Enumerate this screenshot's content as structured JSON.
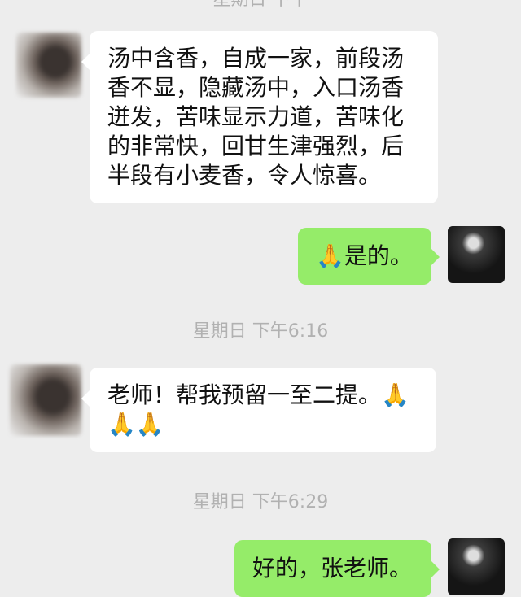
{
  "top_partial_timestamp": "星期日 下午",
  "messages": [
    {
      "side": "in",
      "text": "汤中含香，自成一家，前段汤香不显，隐藏汤中，入口汤香迸发，苦味显示力道，苦味化的非常快，回甘生津强烈，后半段有小麦香，令人惊喜。"
    },
    {
      "side": "out",
      "emoji": "🙏",
      "text": "是的。"
    },
    {
      "timestamp": "星期日 下午6:16"
    },
    {
      "side": "in",
      "text": "老师！帮我预留一至二提。",
      "emojis": "🙏",
      "emoji_line2": "🙏🙏"
    },
    {
      "timestamp": "星期日 下午6:29"
    },
    {
      "side": "out",
      "text": "好的，张老师。"
    }
  ]
}
